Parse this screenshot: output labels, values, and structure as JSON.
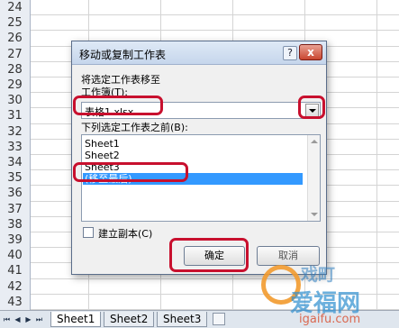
{
  "rows": [
    "24",
    "25",
    "26",
    "27",
    "28",
    "29",
    "30",
    "31",
    "32",
    "33",
    "34",
    "35",
    "36",
    "37",
    "38",
    "39",
    "40",
    "41",
    "42",
    "43"
  ],
  "sheet_nav": {
    "first_icon": "first-sheet-arrow-icon",
    "prev_icon": "prev-sheet-arrow-icon",
    "next_icon": "next-sheet-arrow-icon",
    "last_icon": "last-sheet-arrow-icon"
  },
  "sheet_tabs": [
    "Sheet1",
    "Sheet2",
    "Sheet3"
  ],
  "new_sheet_icon": "insert-sheet-icon",
  "dialog": {
    "title": "移动或复制工作表",
    "help_label": "?",
    "close_label": "x",
    "move_to_label": "将选定工作表移至",
    "workbook_label": "工作簿(T):",
    "workbook_value": "表格1.xlsx",
    "before_label": "下列选定工作表之前(B):",
    "sheets": [
      "Sheet1",
      "Sheet2",
      "Sheet3",
      "(移至最后)"
    ],
    "selected_index": 3,
    "copy_label": "建立副本(C)",
    "copy_checked": false,
    "ok_label": "确定",
    "cancel_label": "取消"
  },
  "colors": {
    "highlight": "#c8102e",
    "selection": "#3399ff"
  },
  "watermark": {
    "line1": "戏町",
    "line2": "爱福网",
    "line3": "igaifu.com"
  }
}
